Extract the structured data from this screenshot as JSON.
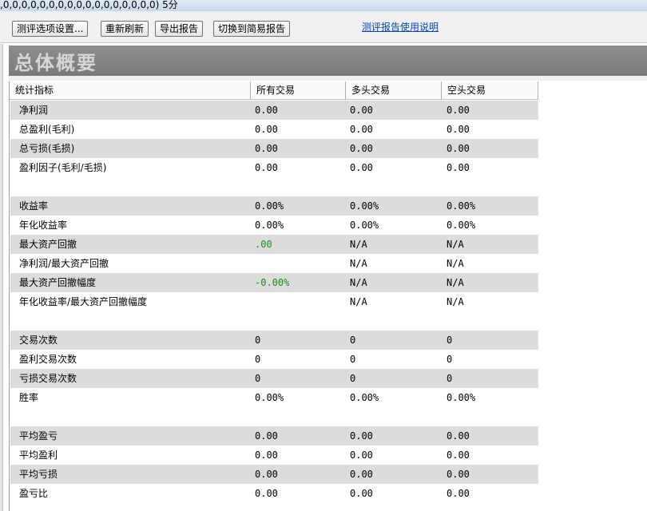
{
  "title_bar": {
    "text": ",0,0,0,0,0,0,0,0,0,0,0,0,0,0,0,0,0) 5分"
  },
  "toolbar": {
    "settings_label": "测评选项设置...",
    "refresh_label": "重新刷新",
    "export_label": "导出报告",
    "switch_label": "切换到简易报告",
    "help_link": "测评报告使用说明"
  },
  "banner": {
    "title": "总体概要"
  },
  "table": {
    "headers": [
      "统计指标",
      "所有交易",
      "多头交易",
      "空头交易"
    ],
    "rows": [
      {
        "label": "净利润",
        "all": "0.00",
        "long": "0.00",
        "short": "0.00",
        "shade": true
      },
      {
        "label": "总盈利(毛利)",
        "all": "0.00",
        "long": "0.00",
        "short": "0.00",
        "shade": false
      },
      {
        "label": "总亏损(毛损)",
        "all": "0.00",
        "long": "0.00",
        "short": "0.00",
        "shade": true
      },
      {
        "label": "盈利因子(毛利/毛损)",
        "all": "0.00",
        "long": "0.00",
        "short": "0.00",
        "shade": false
      },
      {
        "label": "",
        "all": "",
        "long": "",
        "short": "",
        "shade": false
      },
      {
        "label": "收益率",
        "all": "0.00%",
        "long": "0.00%",
        "short": "0.00%",
        "shade": true
      },
      {
        "label": "年化收益率",
        "all": "0.00%",
        "long": "0.00%",
        "short": "0.00%",
        "shade": false
      },
      {
        "label": "最大资产回撤",
        "all": ".00",
        "long": "N/A",
        "short": "N/A",
        "shade": true,
        "all_color": "#1e8c1e"
      },
      {
        "label": "净利润/最大资产回撤",
        "all": "",
        "long": "N/A",
        "short": "N/A",
        "shade": false
      },
      {
        "label": "最大资产回撤幅度",
        "all": "-0.00%",
        "long": "N/A",
        "short": "N/A",
        "shade": true,
        "all_color": "#1e8c1e"
      },
      {
        "label": "年化收益率/最大资产回撤幅度",
        "all": "",
        "long": "N/A",
        "short": "N/A",
        "shade": false
      },
      {
        "label": "",
        "all": "",
        "long": "",
        "short": "",
        "shade": false
      },
      {
        "label": "交易次数",
        "all": "0",
        "long": "0",
        "short": "0",
        "shade": true
      },
      {
        "label": "盈利交易次数",
        "all": "0",
        "long": "0",
        "short": "0",
        "shade": false
      },
      {
        "label": "亏损交易次数",
        "all": "0",
        "long": "0",
        "short": "0",
        "shade": true
      },
      {
        "label": "胜率",
        "all": "0.00%",
        "long": "0.00%",
        "short": "0.00%",
        "shade": false
      },
      {
        "label": "",
        "all": "",
        "long": "",
        "short": "",
        "shade": false
      },
      {
        "label": "平均盈亏",
        "all": "0.00",
        "long": "0.00",
        "short": "0.00",
        "shade": true
      },
      {
        "label": "平均盈利",
        "all": "0.00",
        "long": "0.00",
        "short": "0.00",
        "shade": false
      },
      {
        "label": "平均亏损",
        "all": "0.00",
        "long": "0.00",
        "short": "0.00",
        "shade": true
      },
      {
        "label": "盈亏比",
        "all": "0.00",
        "long": "0.00",
        "short": "0.00",
        "shade": false
      }
    ]
  }
}
